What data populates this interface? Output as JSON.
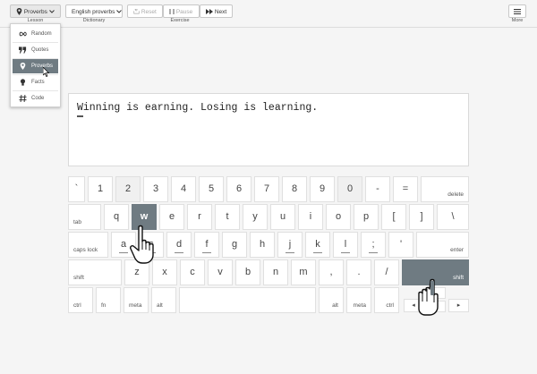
{
  "toolbar": {
    "lesson_label": "Proverbs",
    "lesson_caption": "Lesson",
    "dictionary_label": "English proverbs",
    "dictionary_caption": "Dictionary",
    "reset_label": "Reset",
    "pause_label": "Pause",
    "next_label": "Next",
    "exercise_caption": "Exercise",
    "more_caption": "More"
  },
  "lesson_menu": {
    "items": [
      {
        "label": "Random",
        "icon": "infinity-icon"
      },
      {
        "label": "Quotes",
        "icon": "quote-icon"
      },
      {
        "label": "Proverbs",
        "icon": "pin-icon",
        "selected": true
      },
      {
        "label": "Facts",
        "icon": "lightbulb-icon"
      },
      {
        "label": "Code",
        "icon": "hash-icon"
      }
    ]
  },
  "exercise": {
    "text": "Winning is earning. Losing is learning."
  },
  "keyboard": {
    "row1": [
      "`",
      "1",
      "2",
      "3",
      "4",
      "5",
      "6",
      "7",
      "8",
      "9",
      "0",
      "-",
      "="
    ],
    "delete": "delete",
    "tab": "tab",
    "row2": [
      "q",
      "w",
      "e",
      "r",
      "t",
      "y",
      "u",
      "i",
      "o",
      "p",
      "[",
      "]",
      "\\"
    ],
    "caps": "caps lock",
    "row3": [
      "a",
      "s",
      "d",
      "f",
      "g",
      "h",
      "j",
      "k",
      "l",
      ";",
      "'"
    ],
    "enter": "enter",
    "shift_left": "shift",
    "row4": [
      "z",
      "x",
      "c",
      "v",
      "b",
      "n",
      "m",
      ",",
      ".",
      "/"
    ],
    "shift_right": "shift",
    "ctrl_left": "ctrl",
    "fn": "fn",
    "meta_left": "meta",
    "alt_left": "alt",
    "alt_right": "alt",
    "meta_right": "meta",
    "ctrl_right": "ctrl",
    "arrow_left": "◂",
    "arrow_right": "▸",
    "active_key": "w",
    "active_modifier": "shift_right"
  },
  "colors": {
    "highlight": "#6f7b82"
  }
}
